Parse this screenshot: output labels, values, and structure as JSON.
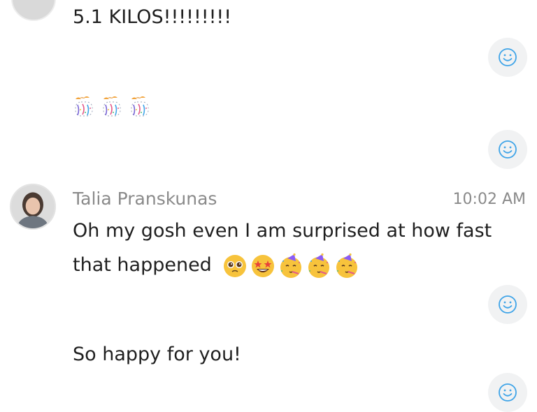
{
  "messages": [
    {
      "text": "5.1 KILOS!!!!!!!!!"
    },
    {
      "emoji": [
        "party-popper",
        "party-popper",
        "party-popper"
      ]
    },
    {
      "sender": "Talia Pranskunas",
      "time": "10:02 AM",
      "line1": "Oh my gosh even I am surprised at how fast",
      "line2": "that happened",
      "emoji": [
        "pleading-face",
        "star-struck-face",
        "partying-face",
        "partying-face",
        "partying-face"
      ]
    },
    {
      "text": "So happy for you!"
    }
  ],
  "colors": {
    "accent": "#3fa4e8",
    "react_bg": "#f1f2f3",
    "meta_text": "#8a8a8a"
  },
  "icons": {
    "react": "smiley-add-reaction-icon"
  }
}
